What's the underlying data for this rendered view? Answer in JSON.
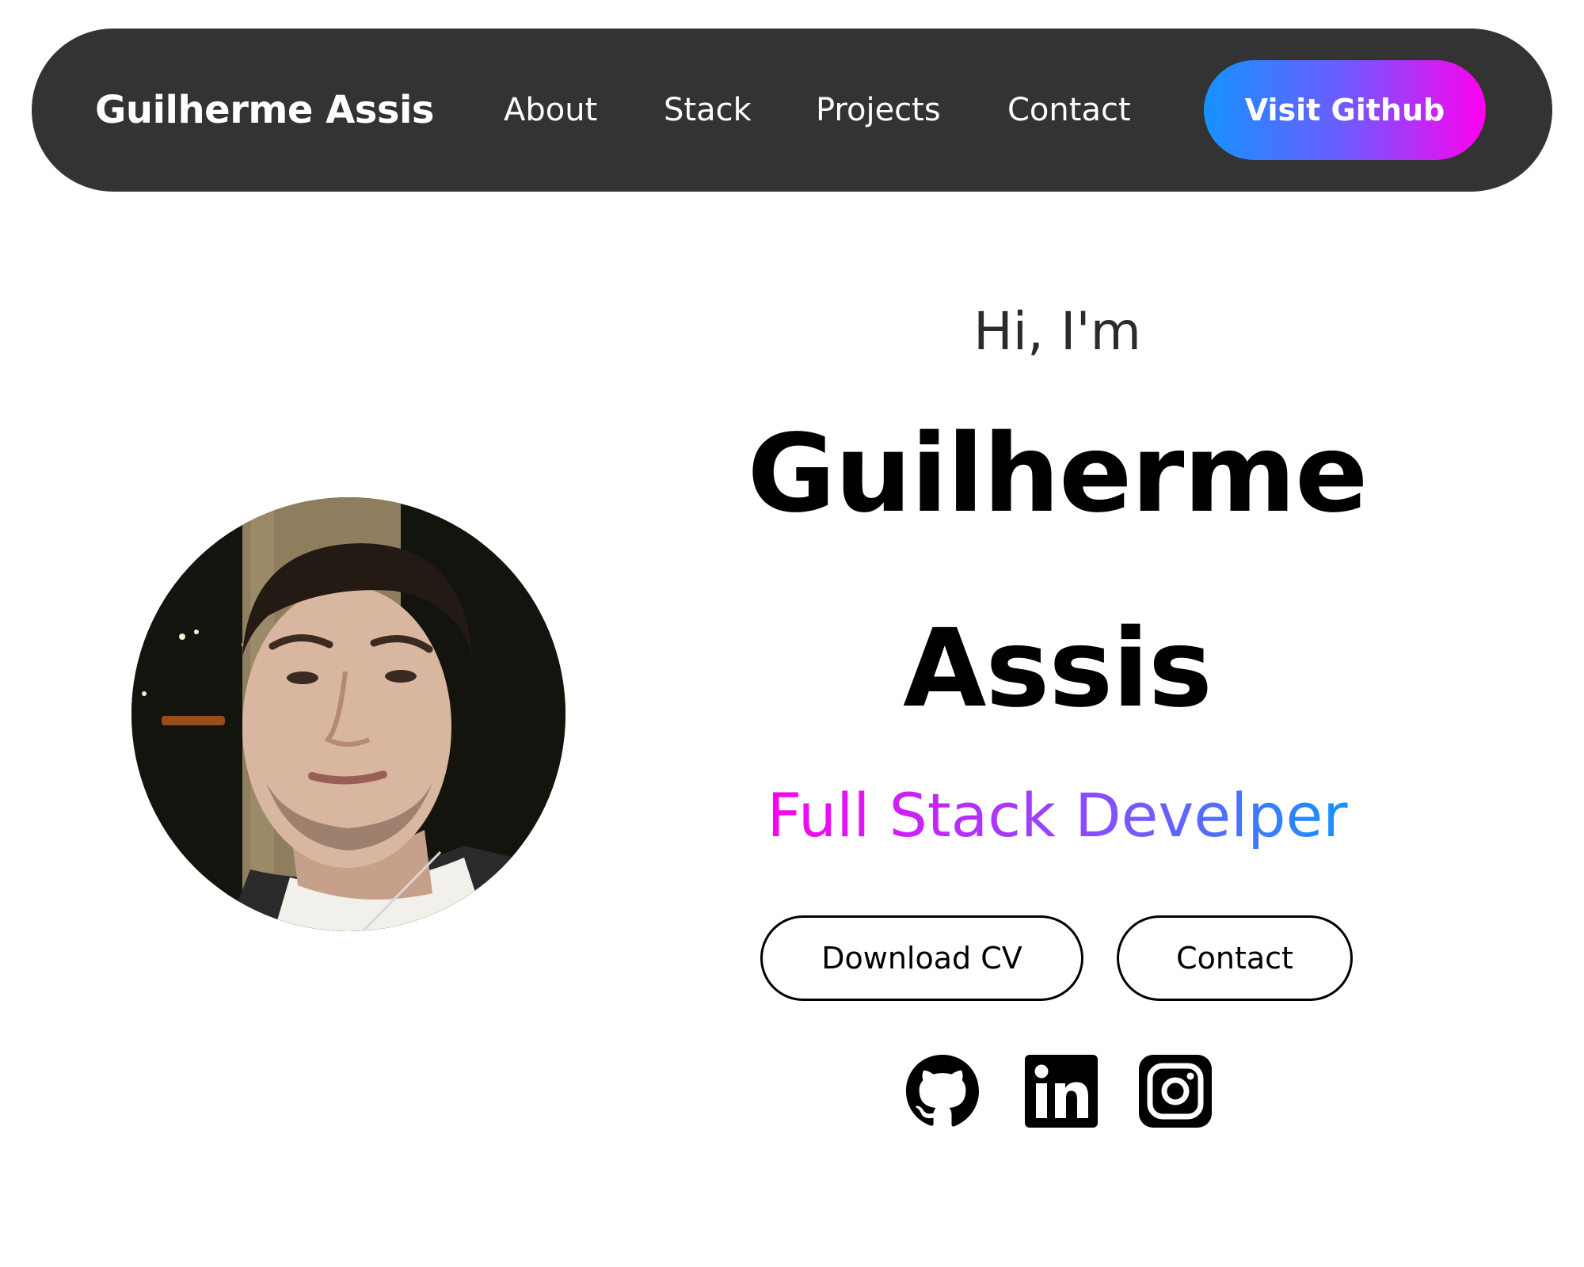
{
  "nav": {
    "brand": "Guilherme Assis",
    "links": [
      "About",
      "Stack",
      "Projects",
      "Contact"
    ],
    "cta_label": "Visit Github"
  },
  "hero": {
    "greeting": "Hi, I'm",
    "name_first": "Guilherme",
    "name_last": "Assis",
    "role": "Full Stack Develper",
    "buttons": {
      "download_cv": "Download CV",
      "contact": "Contact"
    },
    "social_icons": [
      "github-icon",
      "linkedin-icon",
      "instagram-icon"
    ]
  },
  "colors": {
    "navbar_bg": "#333333",
    "gradient_start": "#1592ff",
    "gradient_end": "#ff00ee",
    "text_primary": "#000000"
  }
}
